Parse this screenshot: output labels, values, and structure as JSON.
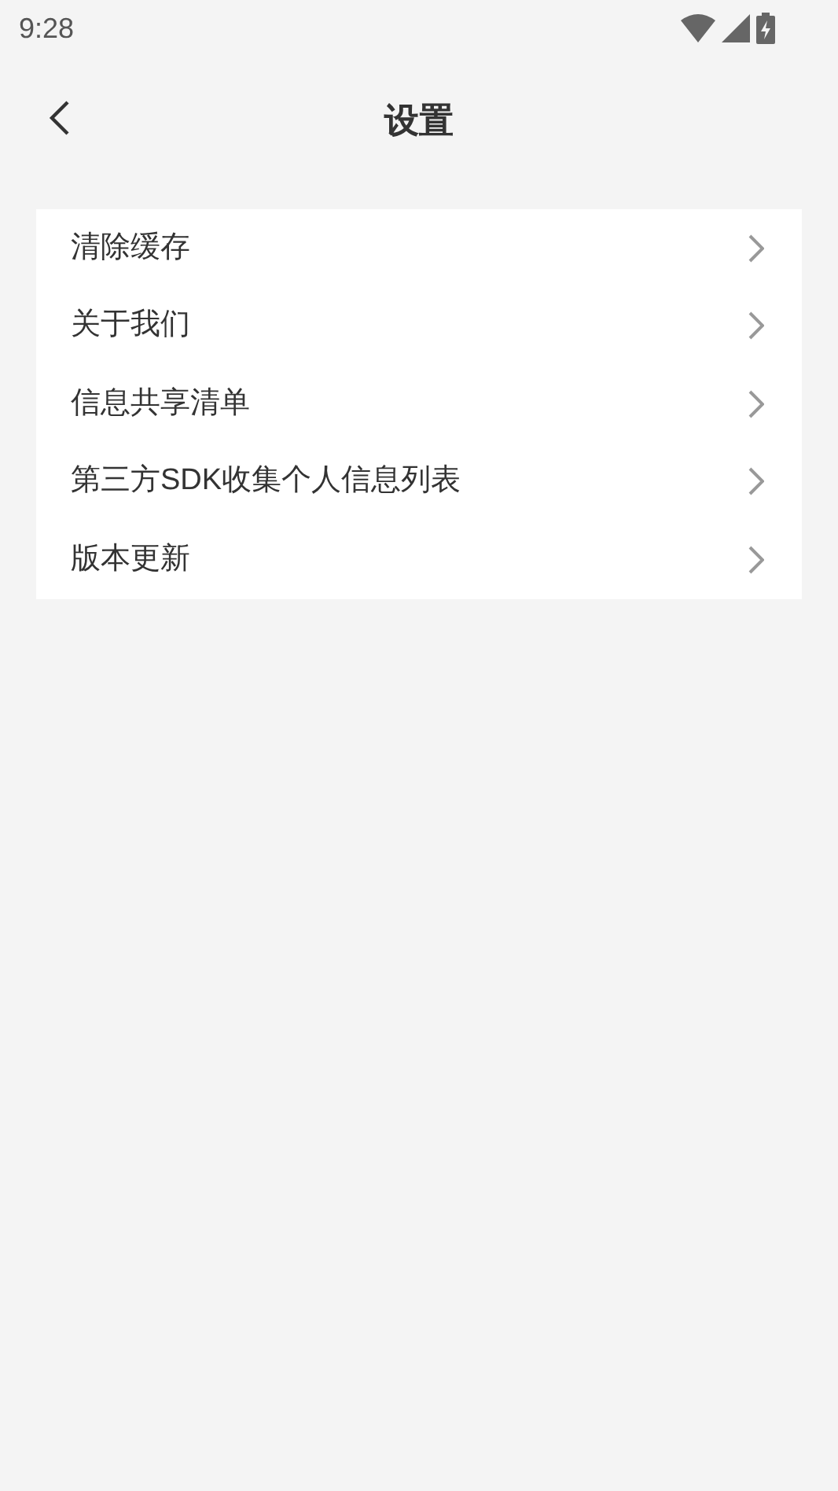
{
  "status_bar": {
    "time": "9:28"
  },
  "header": {
    "title": "设置"
  },
  "menu": [
    {
      "label": "清除缓存"
    },
    {
      "label": "关于我们"
    },
    {
      "label": "信息共享清单"
    },
    {
      "label": "第三方SDK收集个人信息列表"
    },
    {
      "label": "版本更新"
    }
  ]
}
